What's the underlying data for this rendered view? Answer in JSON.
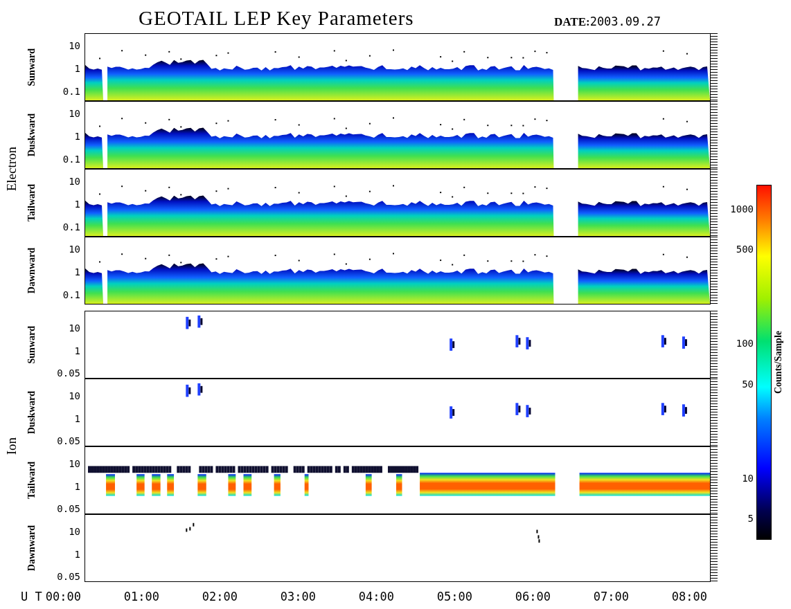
{
  "title": "GEOTAIL LEP Key Parameters",
  "date": {
    "label": "DATE:",
    "value": "2003.09.27"
  },
  "groups": [
    {
      "name": "Electron",
      "panels": [
        {
          "direction": "Sunward",
          "kind": "electron",
          "yticks": [
            "10",
            "1",
            "0.1"
          ]
        },
        {
          "direction": "Duskward",
          "kind": "electron",
          "yticks": [
            "10",
            "1",
            "0.1"
          ]
        },
        {
          "direction": "Tailward",
          "kind": "electron",
          "yticks": [
            "10",
            "1",
            "0.1"
          ]
        },
        {
          "direction": "Dawnward",
          "kind": "electron",
          "yticks": [
            "10",
            "1",
            "0.1"
          ]
        }
      ]
    },
    {
      "name": "Ion",
      "panels": [
        {
          "direction": "Sunward",
          "kind": "ion_sparse",
          "yticks": [
            "10",
            "1",
            "0.05"
          ]
        },
        {
          "direction": "Duskward",
          "kind": "ion_sparse",
          "yticks": [
            "10",
            "1",
            "0.05"
          ]
        },
        {
          "direction": "Tailward",
          "kind": "ion_band",
          "yticks": [
            "10",
            "1",
            "0.05"
          ]
        },
        {
          "direction": "Dawnward",
          "kind": "ion_trace",
          "yticks": [
            "10",
            "1",
            "0.05"
          ]
        }
      ]
    }
  ],
  "time_axis": {
    "label": "U T",
    "ticks": [
      "00:00",
      "01:00",
      "02:00",
      "03:00",
      "04:00",
      "05:00",
      "06:00",
      "07:00",
      "08:00"
    ]
  },
  "colorbar": {
    "title": "Counts/Sample",
    "ticks": [
      "1000",
      "500",
      "100",
      "50",
      "10",
      "5"
    ]
  }
}
